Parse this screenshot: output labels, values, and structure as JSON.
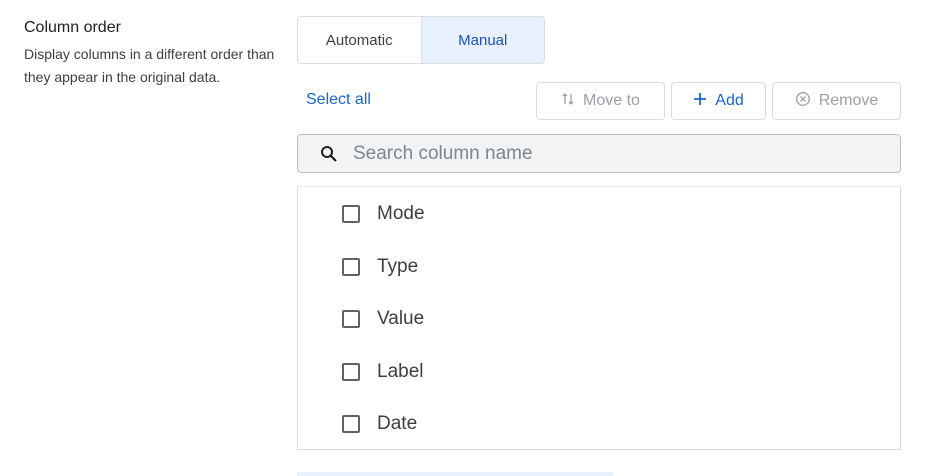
{
  "section": {
    "title": "Column order",
    "description": "Display columns in a different order than they appear in the original data."
  },
  "mode_toggle": {
    "options": [
      "Automatic",
      "Manual"
    ],
    "selected": "Manual"
  },
  "toolbar": {
    "select_all_label": "Select all",
    "move_to_label": "Move to",
    "add_label": "Add",
    "remove_label": "Remove"
  },
  "search": {
    "placeholder": "Search column name",
    "value": ""
  },
  "columns": {
    "items": [
      {
        "label": "Mode",
        "checked": false
      },
      {
        "label": "Type",
        "checked": false
      },
      {
        "label": "Value",
        "checked": false
      },
      {
        "label": "Label",
        "checked": false
      },
      {
        "label": "Date",
        "checked": false
      }
    ]
  },
  "colors": {
    "accent": "#1967d2",
    "selected_bg": "#e8f0fe",
    "disabled_text": "#9aa0a6"
  }
}
